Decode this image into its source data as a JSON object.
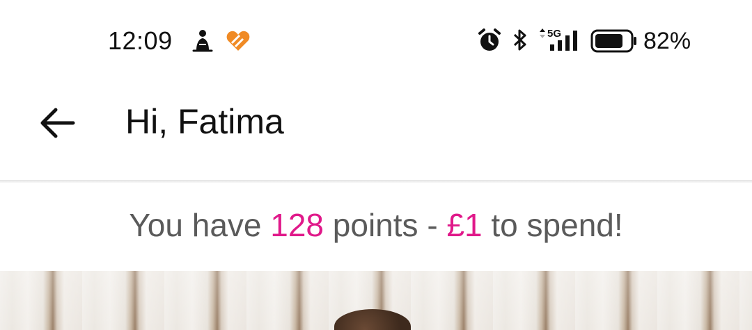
{
  "status_bar": {
    "time": "12:09",
    "battery_percent": "82%",
    "battery_level": 0.82,
    "network": "5G",
    "icons": [
      "person-icon",
      "heart-app-icon",
      "alarm-icon",
      "bluetooth-icon",
      "signal-icon",
      "battery-icon"
    ]
  },
  "header": {
    "title": "Hi, Fatima",
    "back_icon": "back-arrow-icon"
  },
  "points_banner": {
    "prefix": "You have ",
    "points": "128",
    "middle": " points - ",
    "amount": "£1",
    "suffix": " to spend!"
  },
  "colors": {
    "accent": "#e0198a",
    "banner_text": "#5a5a5a",
    "heart_icon": "#f08a24"
  }
}
